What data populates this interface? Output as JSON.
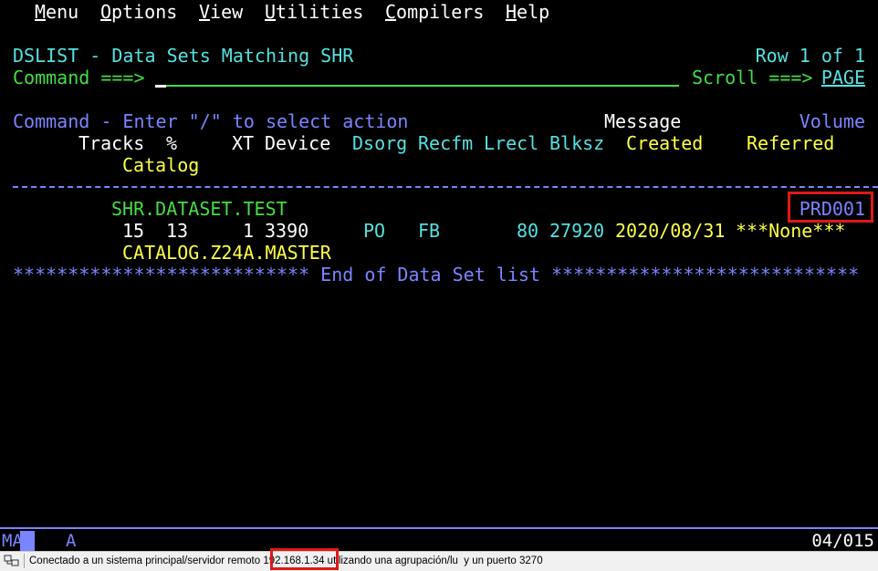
{
  "menu": [
    {
      "pre": "",
      "key": "M",
      "rest": "enu"
    },
    {
      "pre": "",
      "key": "O",
      "rest": "ptions"
    },
    {
      "pre": "",
      "key": "V",
      "rest": "iew"
    },
    {
      "pre": "",
      "key": "U",
      "rest": "tilities"
    },
    {
      "pre": "",
      "key": "C",
      "rest": "ompilers"
    },
    {
      "pre": "",
      "key": "H",
      "rest": "elp"
    }
  ],
  "panel": {
    "title": "DSLIST - Data Sets Matching SHR",
    "row_info": "Row 1 of 1",
    "command_label": "Command ===>",
    "command_value": "",
    "scroll_label": "Scroll ===>",
    "scroll_value": "PAGE"
  },
  "header": {
    "instructions": "Command - Enter \"/\" to select action",
    "message": "Message",
    "volume": "Volume",
    "tracks": "Tracks",
    "pct": "%",
    "xt": "XT",
    "device": "Device",
    "dsorg": "Dsorg",
    "recfm": "Recfm",
    "lrecl": "Lrecl",
    "blksz": "Blksz",
    "created": "Created",
    "referred": "Referred",
    "catalog": "Catalog"
  },
  "dataset": {
    "name": "SHR.DATASET.TEST",
    "volume": "PRD001",
    "tracks": "15",
    "pct": "13",
    "xt": "1",
    "device": "3390",
    "dsorg": "PO",
    "recfm": "FB",
    "lrecl": "80",
    "blksz": "27920",
    "created": "2020/08/31",
    "referred": "***None***",
    "catalog": "CATALOG.Z24A.MASTER"
  },
  "end_line": "*************************** End of Data Set list ****************************",
  "oia": {
    "ma": "MA",
    "mode": "A",
    "cursor_pos": "04/015"
  },
  "status_bar": {
    "msg_before": "Conectado a un sistema principal/servidor remoto ",
    "ip": "192.168.1.34",
    "msg_after": " utilizando una agrupación/lu  y un puerto 3270"
  },
  "colors": {
    "cyan": "#55e1e1",
    "green": "#44dd44",
    "blue": "#7b84ff",
    "yellow": "#ffff44",
    "white": "#ffffff",
    "highlight": "#e01818"
  }
}
